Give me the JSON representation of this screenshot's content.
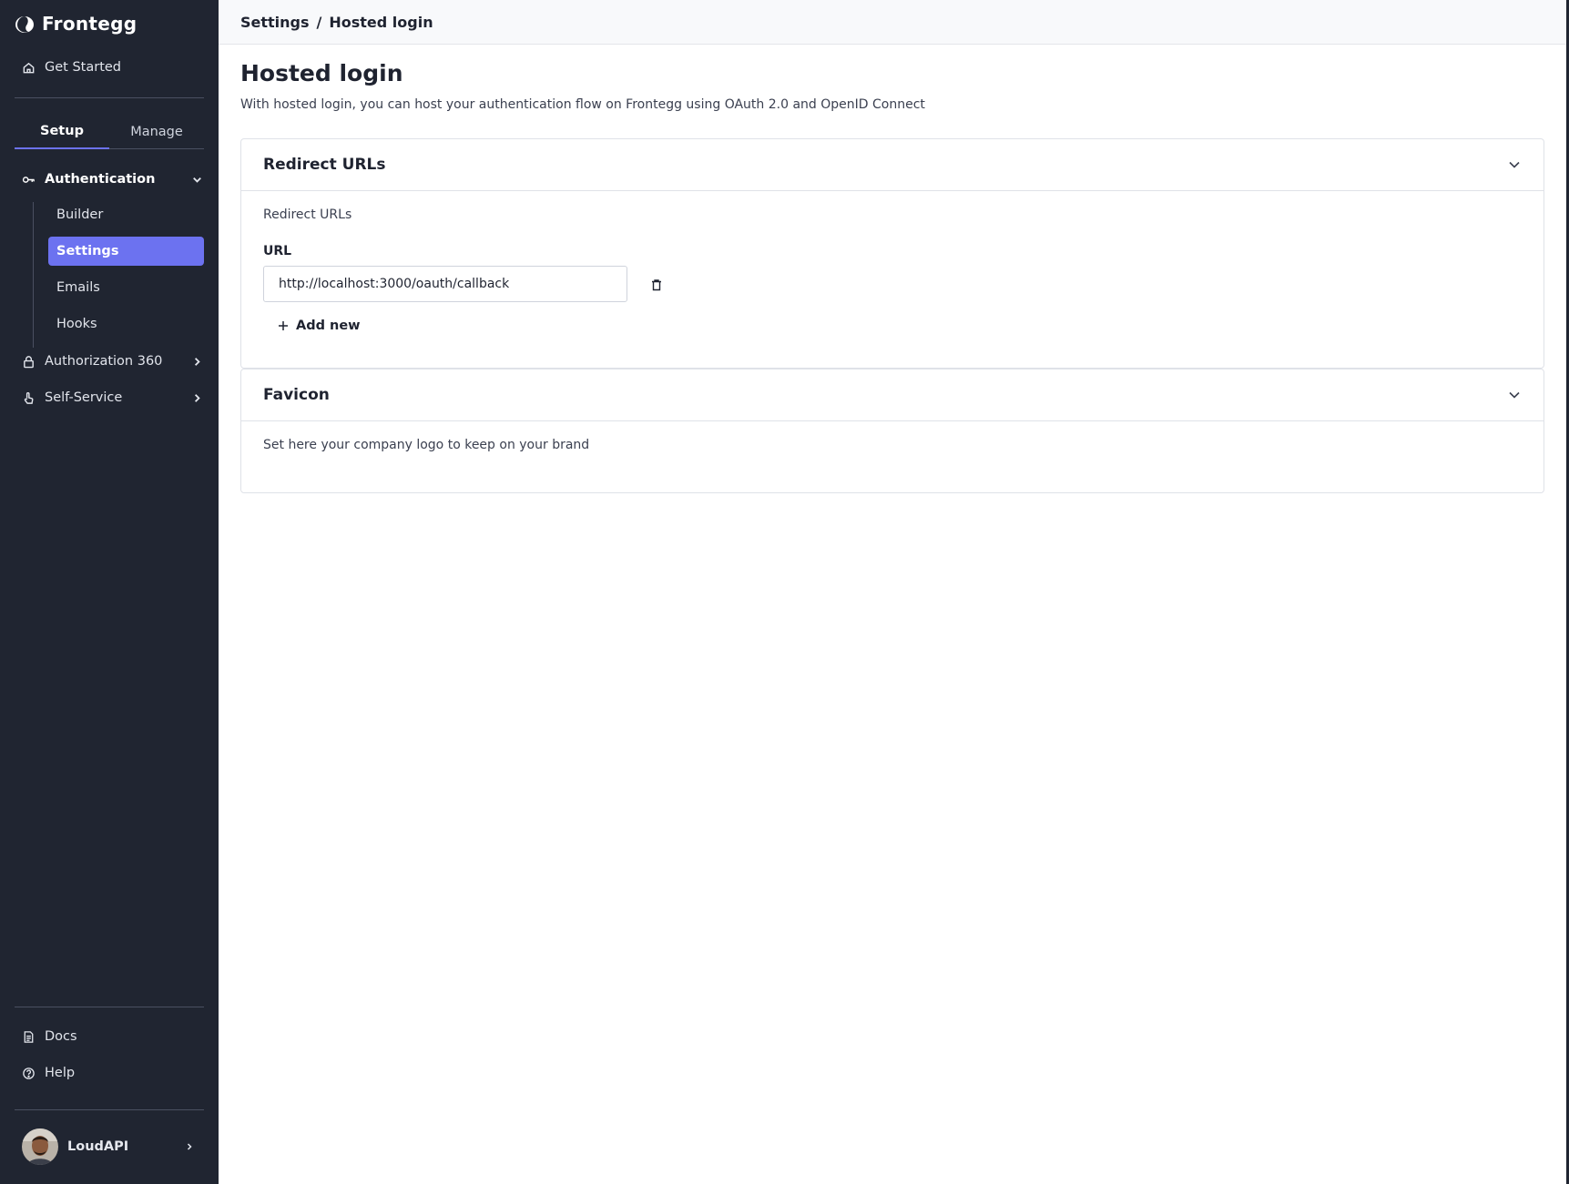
{
  "brand": {
    "name": "Frontegg"
  },
  "sidebar": {
    "get_started": "Get Started",
    "tabs": [
      {
        "label": "Setup",
        "active": true
      },
      {
        "label": "Manage",
        "active": false
      }
    ],
    "authentication": {
      "label": "Authentication",
      "expanded": true,
      "items": [
        {
          "label": "Builder"
        },
        {
          "label": "Settings",
          "active": true
        },
        {
          "label": "Emails"
        },
        {
          "label": "Hooks"
        }
      ]
    },
    "authorization": "Authorization 360",
    "self_service": "Self-Service",
    "docs": "Docs",
    "help": "Help",
    "user": {
      "name": "LoudAPI"
    },
    "icons": [
      "home-icon",
      "key-icon",
      "lock-icon",
      "pointer-hand-icon",
      "document-icon",
      "help-circle-icon",
      "chevron-down-icon",
      "chevron-right-icon"
    ]
  },
  "breadcrumb": {
    "parent": "Settings",
    "separator": "/",
    "current": "Hosted login"
  },
  "page": {
    "title": "Hosted login",
    "subtitle": "With hosted login, you can host your authentication flow on Frontegg using OAuth 2.0 and OpenID Connect"
  },
  "redirect_card": {
    "title": "Redirect URLs",
    "section_label": "Redirect URLs",
    "field_label": "URL",
    "url_value": "http://localhost:3000/oauth/callback",
    "add_new": "Add new"
  },
  "favicon_card": {
    "title": "Favicon",
    "description": "Set here your company logo to keep on your brand"
  },
  "colors": {
    "sidebar_bg": "#202531",
    "accent": "#6c72f0",
    "topbar_bg": "#f8f9fb"
  }
}
